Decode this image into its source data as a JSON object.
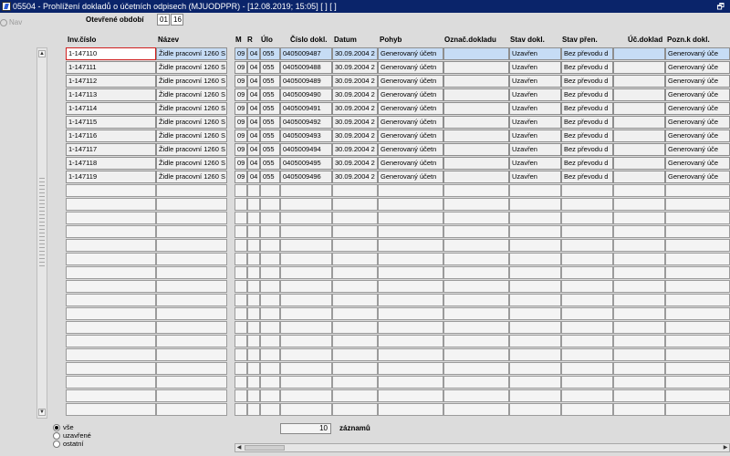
{
  "window": {
    "title": "05504 - Prohlížení dokladů o účetních odpisech (MJUODPPR) - [12.08.2019; 15:05]  [ ]  [ ]",
    "restore_icon": "restore-window-icon"
  },
  "nav": {
    "label": "Nav"
  },
  "period": {
    "label": "Otevřené období",
    "month": "01",
    "year": "16"
  },
  "columns": [
    {
      "key": "inv",
      "label": "Inv.číslo"
    },
    {
      "key": "nazev",
      "label": "Název"
    },
    {
      "key": "m",
      "label": "M"
    },
    {
      "key": "r",
      "label": "R"
    },
    {
      "key": "ulo",
      "label": "Úlo"
    },
    {
      "key": "cislo",
      "label": "Číslo dokl."
    },
    {
      "key": "datum",
      "label": "Datum"
    },
    {
      "key": "pohyb",
      "label": "Pohyb"
    },
    {
      "key": "oznac",
      "label": "Označ.dokladu"
    },
    {
      "key": "stav",
      "label": "Stav dokl."
    },
    {
      "key": "stavpren",
      "label": "Stav přen."
    },
    {
      "key": "ucdoklad",
      "label": "Úč.doklad"
    },
    {
      "key": "pozn",
      "label": "Pozn.k dokl."
    }
  ],
  "rows": [
    {
      "inv": "1-147110",
      "nazev": "Židle pracovní 1260 S",
      "m": "09",
      "r": "04",
      "ulo": "055",
      "cislo": "0405009487",
      "datum": "30.09.2004 2",
      "pohyb": "Generovaný účetn",
      "oznac": "",
      "stav": "Uzavřen",
      "stavpren": "Bez převodu d",
      "ucdoklad": "",
      "pozn": "Generovaný úče"
    },
    {
      "inv": "1-147111",
      "nazev": "Židle pracovní 1260 S",
      "m": "09",
      "r": "04",
      "ulo": "055",
      "cislo": "0405009488",
      "datum": "30.09.2004 2",
      "pohyb": "Generovaný účetn",
      "oznac": "",
      "stav": "Uzavřen",
      "stavpren": "Bez převodu d",
      "ucdoklad": "",
      "pozn": "Generovaný úče"
    },
    {
      "inv": "1-147112",
      "nazev": "Židle pracovní 1260 S",
      "m": "09",
      "r": "04",
      "ulo": "055",
      "cislo": "0405009489",
      "datum": "30.09.2004 2",
      "pohyb": "Generovaný účetn",
      "oznac": "",
      "stav": "Uzavřen",
      "stavpren": "Bez převodu d",
      "ucdoklad": "",
      "pozn": "Generovaný úče"
    },
    {
      "inv": "1-147113",
      "nazev": "Židle pracovní 1260 S",
      "m": "09",
      "r": "04",
      "ulo": "055",
      "cislo": "0405009490",
      "datum": "30.09.2004 2",
      "pohyb": "Generovaný účetn",
      "oznac": "",
      "stav": "Uzavřen",
      "stavpren": "Bez převodu d",
      "ucdoklad": "",
      "pozn": "Generovaný úče"
    },
    {
      "inv": "1-147114",
      "nazev": "Židle pracovní 1260 S",
      "m": "09",
      "r": "04",
      "ulo": "055",
      "cislo": "0405009491",
      "datum": "30.09.2004 2",
      "pohyb": "Generovaný účetn",
      "oznac": "",
      "stav": "Uzavřen",
      "stavpren": "Bez převodu d",
      "ucdoklad": "",
      "pozn": "Generovaný úče"
    },
    {
      "inv": "1-147115",
      "nazev": "Židle pracovní 1260 S",
      "m": "09",
      "r": "04",
      "ulo": "055",
      "cislo": "0405009492",
      "datum": "30.09.2004 2",
      "pohyb": "Generovaný účetn",
      "oznac": "",
      "stav": "Uzavřen",
      "stavpren": "Bez převodu d",
      "ucdoklad": "",
      "pozn": "Generovaný úče"
    },
    {
      "inv": "1-147116",
      "nazev": "Židle pracovní 1260 S",
      "m": "09",
      "r": "04",
      "ulo": "055",
      "cislo": "0405009493",
      "datum": "30.09.2004 2",
      "pohyb": "Generovaný účetn",
      "oznac": "",
      "stav": "Uzavřen",
      "stavpren": "Bez převodu d",
      "ucdoklad": "",
      "pozn": "Generovaný úče"
    },
    {
      "inv": "1-147117",
      "nazev": "Židle pracovní 1260 S",
      "m": "09",
      "r": "04",
      "ulo": "055",
      "cislo": "0405009494",
      "datum": "30.09.2004 2",
      "pohyb": "Generovaný účetn",
      "oznac": "",
      "stav": "Uzavřen",
      "stavpren": "Bez převodu d",
      "ucdoklad": "",
      "pozn": "Generovaný úče"
    },
    {
      "inv": "1-147118",
      "nazev": "Židle pracovní 1260 S",
      "m": "09",
      "r": "04",
      "ulo": "055",
      "cislo": "0405009495",
      "datum": "30.09.2004 2",
      "pohyb": "Generovaný účetn",
      "oznac": "",
      "stav": "Uzavřen",
      "stavpren": "Bez převodu d",
      "ucdoklad": "",
      "pozn": "Generovaný úče"
    },
    {
      "inv": "1-147119",
      "nazev": "Židle pracovní 1260 S",
      "m": "09",
      "r": "04",
      "ulo": "055",
      "cislo": "0405009496",
      "datum": "30.09.2004 2",
      "pohyb": "Generovaný účetn",
      "oznac": "",
      "stav": "Uzavřen",
      "stavpren": "Bez převodu d",
      "ucdoklad": "",
      "pozn": "Generovaný úče"
    }
  ],
  "empty_row_count": 17,
  "selected_row": 0,
  "filter": {
    "options": [
      {
        "label": "vše",
        "selected": true
      },
      {
        "label": "uzavřené",
        "selected": false
      },
      {
        "label": "ostatní",
        "selected": false
      }
    ]
  },
  "record_count": {
    "value": "10",
    "label": "záznamů"
  },
  "colors": {
    "titlebar": "#0a246a",
    "selected_row": "#c6dcf5",
    "current_cell_border": "#d02020",
    "background": "#dcdcdc"
  },
  "icons": {
    "scroll_up": "arrow-up-icon",
    "scroll_down": "arrow-down-icon",
    "scroll_left": "arrow-left-icon",
    "scroll_right": "arrow-right-icon"
  }
}
